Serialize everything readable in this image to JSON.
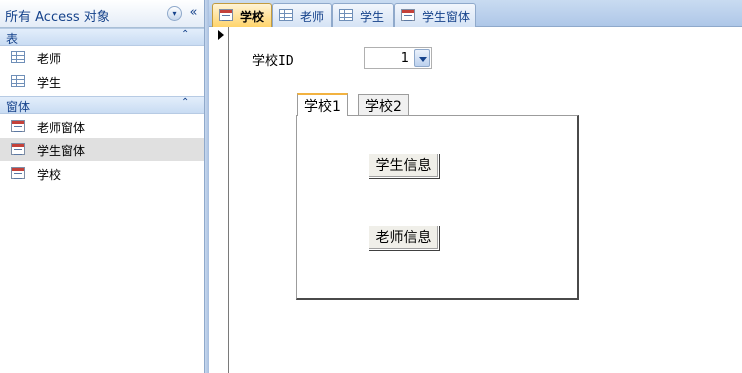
{
  "nav": {
    "title": "所有 Access 对象",
    "menu_glyph": "▾",
    "collapse_glyph": "«",
    "groups": [
      {
        "label": "表",
        "chevron": "⌃",
        "items": [
          {
            "label": "老师"
          },
          {
            "label": "学生"
          }
        ]
      },
      {
        "label": "窗体",
        "chevron": "⌃",
        "items": [
          {
            "label": "老师窗体"
          },
          {
            "label": "学生窗体",
            "selected": true
          },
          {
            "label": "学校"
          }
        ]
      }
    ]
  },
  "doc_tabs": [
    {
      "label": "学校",
      "icon": "form-icon",
      "active": true
    },
    {
      "label": "老师",
      "icon": "table-icon"
    },
    {
      "label": "学生",
      "icon": "table-icon"
    },
    {
      "label": "学生窗体",
      "icon": "form-icon"
    }
  ],
  "form": {
    "school_id_label": "学校ID",
    "school_id_value": "1",
    "tabs": [
      {
        "label": "学校1",
        "active": true
      },
      {
        "label": "学校2"
      }
    ],
    "buttons": {
      "student_info": "学生信息",
      "teacher_info": "老师信息"
    }
  }
}
